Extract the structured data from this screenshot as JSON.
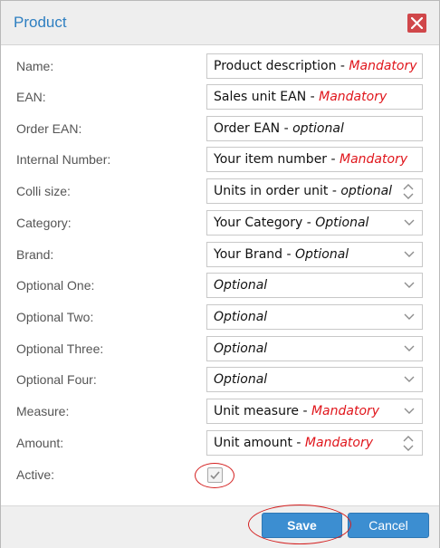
{
  "dialog": {
    "title": "Product",
    "close_icon": "close-icon"
  },
  "fields": [
    {
      "label": "Name:",
      "main": "Product description",
      "sep": " - ",
      "hint": "Mandatory",
      "hint_type": "mandatory",
      "control": "text"
    },
    {
      "label": "EAN:",
      "main": "Sales unit EAN",
      "sep": " - ",
      "hint": "Mandatory",
      "hint_type": "mandatory",
      "control": "text"
    },
    {
      "label": "Order EAN:",
      "main": "Order EAN",
      "sep": " - ",
      "hint": "optional",
      "hint_type": "optional",
      "control": "text"
    },
    {
      "label": "Internal Number:",
      "main": "Your item number",
      "sep": " - ",
      "hint": "Mandatory",
      "hint_type": "mandatory",
      "control": "text"
    },
    {
      "label": "Colli size:",
      "main": "Units in order unit",
      "sep": " - ",
      "hint": "optional",
      "hint_type": "optional",
      "control": "number"
    },
    {
      "label": "Category:",
      "main": "Your Category",
      "sep": " - ",
      "hint": "Optional",
      "hint_type": "optional",
      "control": "select"
    },
    {
      "label": "Brand:",
      "main": "Your Brand",
      "sep": " - ",
      "hint": "Optional",
      "hint_type": "optional",
      "control": "select"
    },
    {
      "label": "Optional One:",
      "main": "",
      "sep": "",
      "hint": "Optional",
      "hint_type": "optional",
      "control": "select"
    },
    {
      "label": "Optional Two:",
      "main": "",
      "sep": "",
      "hint": "Optional",
      "hint_type": "optional",
      "control": "select"
    },
    {
      "label": "Optional Three:",
      "main": "",
      "sep": "",
      "hint": "Optional",
      "hint_type": "optional",
      "control": "select"
    },
    {
      "label": "Optional Four:",
      "main": "",
      "sep": "",
      "hint": "Optional",
      "hint_type": "optional",
      "control": "select"
    },
    {
      "label": "Measure:",
      "main": "Unit measure",
      "sep": " - ",
      "hint": "Mandatory",
      "hint_type": "mandatory",
      "control": "select"
    },
    {
      "label": "Amount:",
      "main": "Unit amount",
      "sep": " - ",
      "hint": "Mandatory",
      "hint_type": "mandatory",
      "control": "number"
    }
  ],
  "active": {
    "label": "Active:",
    "checked": true
  },
  "footer": {
    "save_label": "Save",
    "cancel_label": "Cancel"
  },
  "colors": {
    "title": "#2e7fc1",
    "close_bg": "#d0474a",
    "mandatory": "#e0151b",
    "button": "#3c8ed1",
    "annotation_ring": "#d41f1f"
  }
}
